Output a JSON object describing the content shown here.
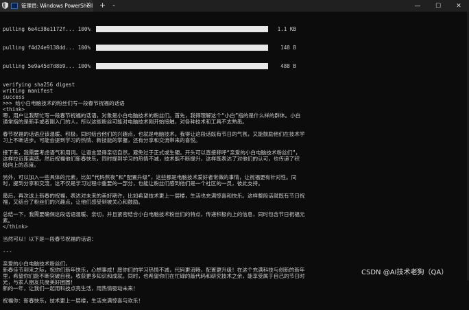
{
  "window": {
    "tab_title": "管理员: Windows PowerShell",
    "close_glyph": "×",
    "new_tab_glyph": "+",
    "dropdown_glyph": "⌄",
    "minimize_glyph": "—",
    "maximize_glyph": "☐",
    "window_close_glyph": "✕"
  },
  "terminal": {
    "pulls": [
      {
        "text": "pulling 6e4c38e1172f... 100%",
        "size": "1.1 KB"
      },
      {
        "text": "pulling f4d24e9138dd... 100%",
        "size": "148 B"
      },
      {
        "text": "pulling 5e9a45d7d8b9... 100%",
        "size": "488 B"
      }
    ],
    "lines": [
      "verifying sha256 digest",
      "writing manifest",
      "success",
      ">>> 给小白电脑技术的粉丝们写一段春节祝福的话语",
      "<think>",
      "嗯，用户让我帮忙写一段春节祝福的话语，对象是小白电脑技术的粉丝们。首先，我得理解这个“小白”指的是什么样的群体。小白",
      "通常指的是新手或者刚入门的人，所以这些粉丝可能对电脑技术刚开始接触，对各种技术和工具不太熟悉。",
      "",
      "春节祝福的话语应该温暖、积极，同时结合他们的兴趣点，也就是电脑技术。我得让这段话既有节日的气氛，又能鼓励他们在技术学",
      "习上不断进步。可能会提到学习的热情、新技能的掌握，还有分享和交流带来的喜悦。",
      "",
      "接下来，我需要考虑语气和用词。让语言显得亲切自然，避免过于正式或生硬。开头可以直接称呼“亲爱的小白电脑技术粉丝们”，",
      "这样拉近距离感。然后祝福他们新春快乐，同时提到学习的热情不减，技术能不断提升，这样既表达了对他们的认可，也传递了积",
      "极向上的态度。",
      "",
      "另外，可以加入一些具体的元素，比如“代码熬夜”和“配置升级”，这些都是电脑技术爱好者常做的事情，让祝福更有针对性。同",
      "时，提到分享和交流，这不仅是学习过程中重要的一部分，也能让粉丝们感到他们是一个社区的一员，彼此支持。",
      "",
      "最后，再次送上新春的祝福，表达对未来的美好期许，比如希望技术更上一层楼，生活也充满惊喜和快乐。这样整段话就既有节日祝",
      "福，又结合了粉丝们的兴趣点，让他们感受到被关心和鼓励。",
      "",
      "总结一下，我需要确保这段话语温暖、亲切，并且紧密结合小白电脑技术粉丝们的特点，传递积极向上的信息，同时包含节日祝福元",
      "素。",
      "</think>",
      "",
      "当然可以！以下是一段春节祝福的话语：",
      "",
      "---",
      "",
      "亲爱的小白电脑技术粉丝们，",
      "新春佳节到来之际，祝你们新年快乐，心想事成！愿你们的学习热情不减，代码更流畅，配置更升级！在这个充满科技与创新的新年",
      "里，希望你们能不断突破自我，收获更多知识和成就。同时，也希望你们在忙碌的敲代码和研究技术之余，能享受属于自己的节日时",
      "光，与家人朋友共度美好团圆！",
      "新的一年，让我们一起用科技点亮生活，用热情驱动未来！",
      "",
      "祝福你：新春快乐，技术更上一层楼，生活充满惊喜与欢乐！"
    ]
  },
  "watermark": "CSDN @AI技术老狗（QA）"
}
